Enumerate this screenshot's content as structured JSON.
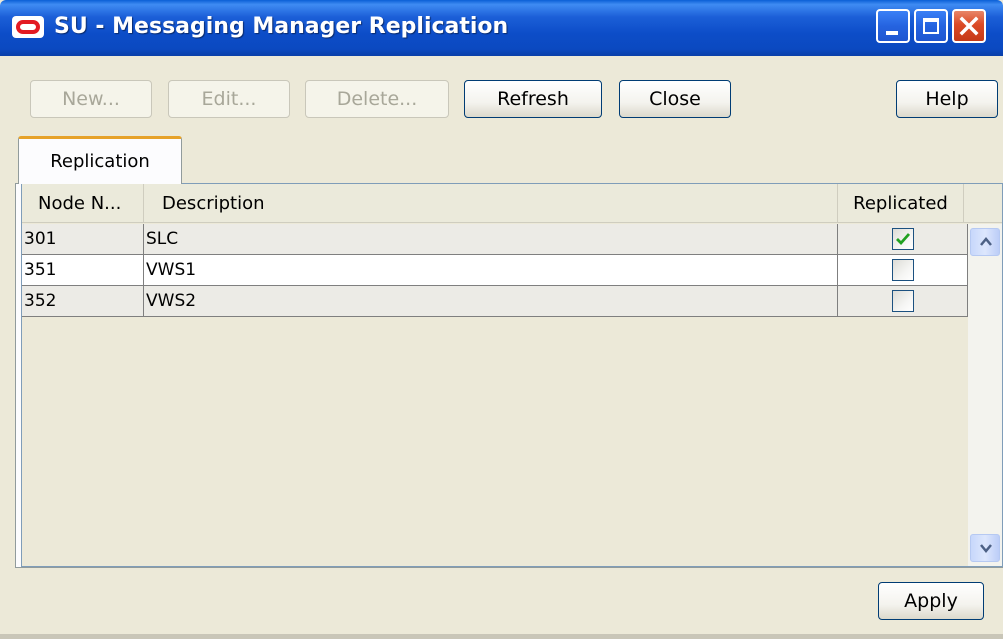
{
  "window": {
    "title": "SU - Messaging Manager Replication",
    "icon": "oracle-logo-icon"
  },
  "toolbar": {
    "new_label": "New...",
    "edit_label": "Edit...",
    "delete_label": "Delete...",
    "refresh_label": "Refresh",
    "close_label": "Close",
    "help_label": "Help"
  },
  "tabs": [
    {
      "label": "Replication",
      "selected": true
    }
  ],
  "table": {
    "columns": [
      "Node N...",
      "Description",
      "Replicated"
    ],
    "rows": [
      {
        "node": "301",
        "description": "SLC",
        "replicated": true
      },
      {
        "node": "351",
        "description": "VWS1",
        "replicated": false
      },
      {
        "node": "352",
        "description": "VWS2",
        "replicated": false
      }
    ]
  },
  "footer": {
    "apply_label": "Apply"
  },
  "colors": {
    "titlebar": "#0b49c0",
    "close_button": "#db4a26",
    "tab_accent": "#e6a22a",
    "check": "#21a121"
  }
}
